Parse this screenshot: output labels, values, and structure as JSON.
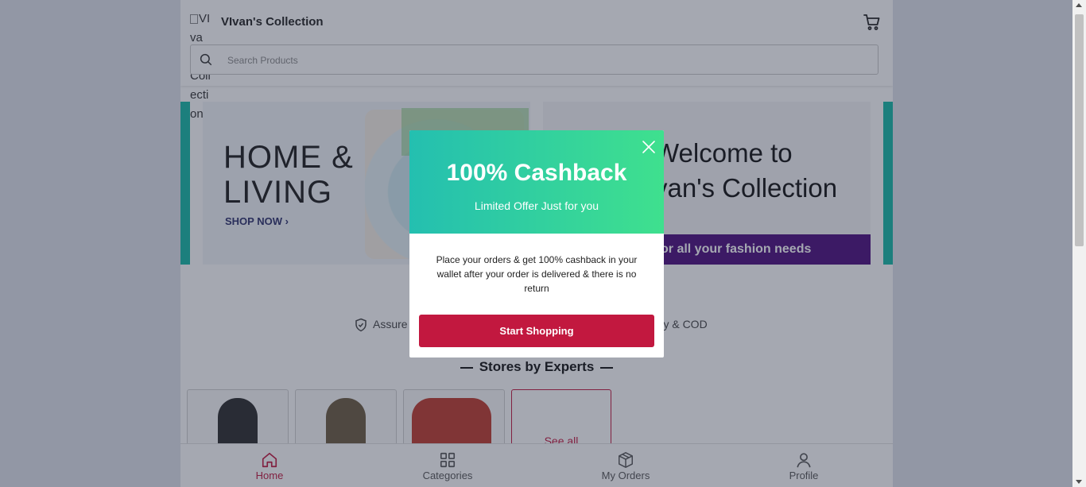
{
  "header": {
    "logo_alt": "VIvan's Collection",
    "brand": "VIvan's Collection",
    "search_placeholder": "Search Products"
  },
  "banners": {
    "home_title_1": "HOME &",
    "home_title_2": "LIVING",
    "shop_now": "SHOP NOW",
    "welcome_1": "Welcome to",
    "welcome_2": "van's Collection",
    "strip": "or all your fashion needs"
  },
  "features": {
    "assured": "Assure",
    "delivery": "very & COD"
  },
  "stores": {
    "title": "Stores by Experts",
    "see_all": "See all"
  },
  "bottom_nav": [
    {
      "label": "Home",
      "icon": "home-icon",
      "active": true
    },
    {
      "label": "Categories",
      "icon": "grid-icon",
      "active": false
    },
    {
      "label": "My Orders",
      "icon": "box-icon",
      "active": false
    },
    {
      "label": "Profile",
      "icon": "user-icon",
      "active": false
    }
  ],
  "modal": {
    "title": "100% Cashback",
    "subtitle": "Limited Offer Just for you",
    "body": "Place your orders & get 100% cashback in your wallet after your order is delivered & there is no return",
    "button": "Start Shopping"
  },
  "colors": {
    "accent": "#c2183f",
    "modal_gradient_start": "#24bfb0",
    "modal_gradient_end": "#3fe08e",
    "strip_purple": "#4a0b7d"
  }
}
